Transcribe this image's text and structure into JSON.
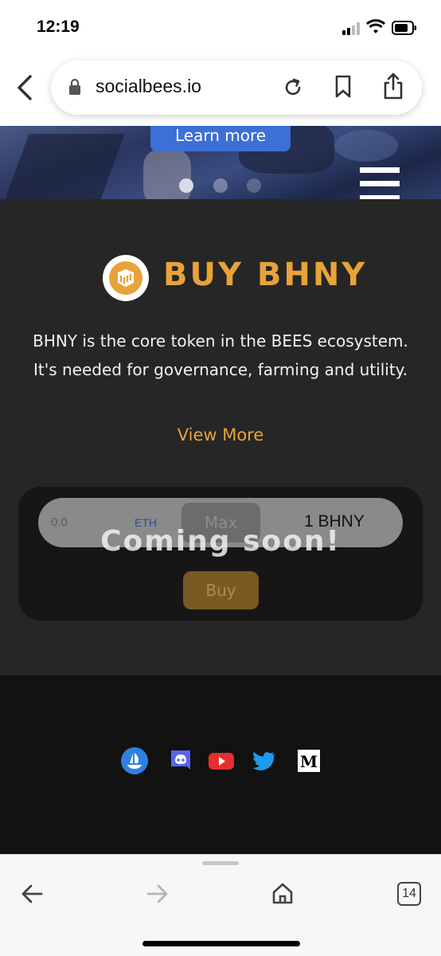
{
  "status_bar": {
    "time": "12:19"
  },
  "browser": {
    "url": "socialbees.io",
    "tab_count": "14"
  },
  "hero": {
    "learn_more_label": "Learn more",
    "slide_count": 3,
    "active_slide": 1
  },
  "buy_section": {
    "title": "BUY BHNY",
    "description": "BHNY is the core token in the BEES ecosystem. It's needed for governance, farming and utility.",
    "view_more_label": "View More",
    "amount_placeholder": "0.0",
    "currency": "ETH",
    "max_label": "Max",
    "receive_amount": "1 BHNY",
    "coming_soon_label": "Coming soon!",
    "buy_label": "Buy"
  },
  "footer": {
    "social_icons": [
      "opensea-icon",
      "discord-icon",
      "youtube-icon",
      "twitter-icon",
      "medium-icon"
    ]
  },
  "colors": {
    "accent": "#e9a23a",
    "background": "#262626",
    "footer": "#121212",
    "learn_more_button": "#3d6fd6"
  }
}
